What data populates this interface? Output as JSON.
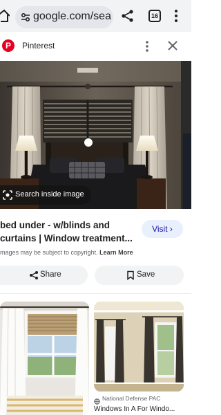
{
  "browser": {
    "url": "google.com/sea",
    "tab_count": "16"
  },
  "source": {
    "name": "Pinterest",
    "logo_letter": "P",
    "logo_color": "#e60023"
  },
  "image_overlay": {
    "search_inside_label": "Search inside image"
  },
  "result": {
    "title": "bed under - w/blinds and\ncurtains | Window treatment...",
    "visit_label": "Visit",
    "visit_chevron": "›",
    "copyright_notice": "mages may be subject to copyright.",
    "learn_more_label": "Learn More"
  },
  "actions": {
    "share_label": "Share",
    "save_label": "Save"
  },
  "related": [
    {},
    {
      "source_name": "National Defense PAC",
      "title": "Windows In A For Windo..."
    }
  ],
  "colors": {
    "toolbar_bg": "#f1f3f4",
    "urlbar_bg": "#e3e6ea",
    "visit_bg": "#e8f0fe",
    "visit_text": "#1a0dab"
  }
}
